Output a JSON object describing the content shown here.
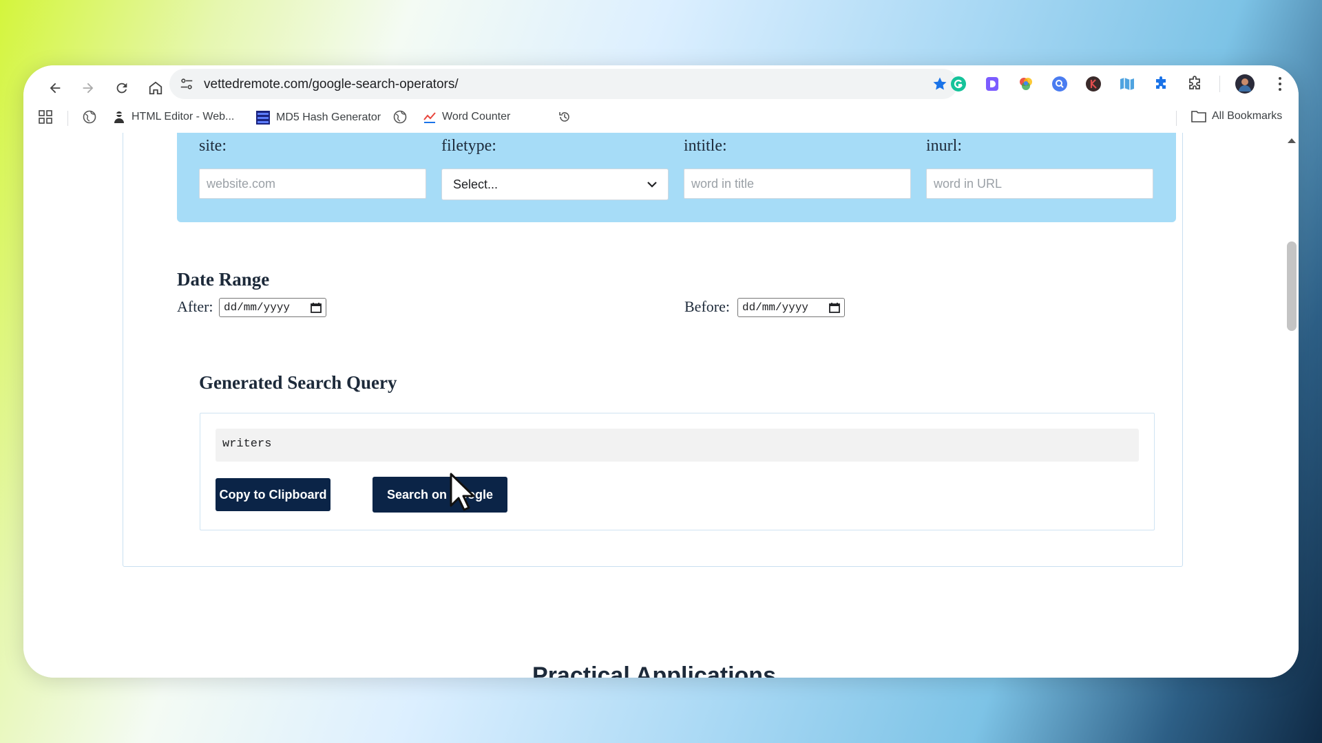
{
  "browser": {
    "url": "vettedremote.com/google-search-operators/",
    "bookmarks": [
      {
        "label": "HTML Editor - Web..."
      },
      {
        "label": "MD5 Hash Generator"
      },
      {
        "label": "Word Counter"
      }
    ],
    "all_bookmarks_label": "All Bookmarks"
  },
  "operators": {
    "site_label": "site:",
    "site_placeholder": "website.com",
    "filetype_label": "filetype:",
    "filetype_selected": "Select...",
    "intitle_label": "intitle:",
    "intitle_placeholder": "word in title",
    "inurl_label": "inurl:",
    "inurl_placeholder": "word in URL"
  },
  "date_range": {
    "title": "Date Range",
    "after_label": "After:",
    "before_label": "Before:",
    "after_value": "dd/mm/yyyy",
    "before_value": "dd/mm/yyyy"
  },
  "generated": {
    "title": "Generated Search Query",
    "query": "writers",
    "copy_label": "Copy to Clipboard",
    "search_label": "Search on Google"
  },
  "next_section": {
    "title": "Practical Applications"
  },
  "colors": {
    "operators_bg": "#a6dcf7",
    "button_bg": "#0b2447",
    "star": "#1a73e8"
  }
}
